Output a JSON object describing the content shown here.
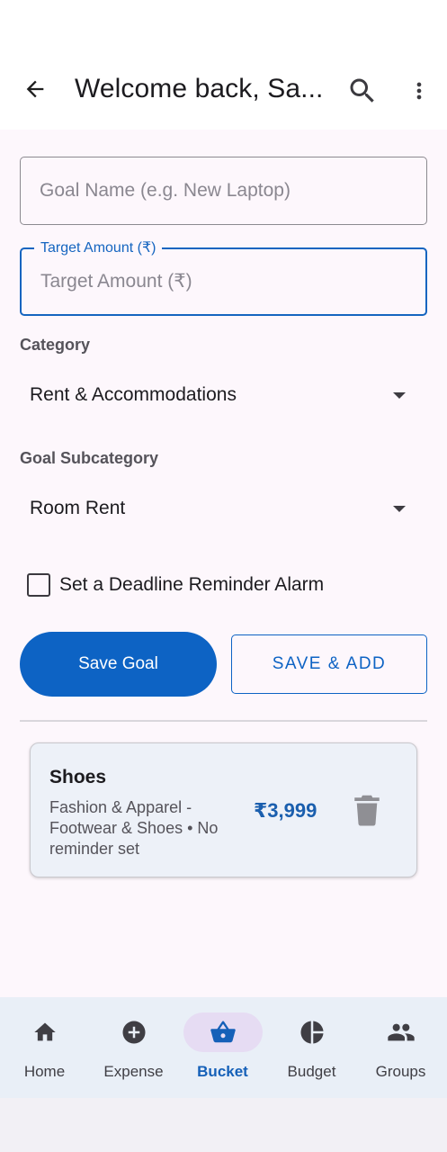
{
  "app_bar": {
    "title": "Welcome back, Sa...",
    "icons": {
      "back": "arrow-left-icon",
      "search": "search-icon",
      "more": "more-vertical-icon"
    }
  },
  "form": {
    "goal_name": {
      "value": "",
      "placeholder": "Goal Name (e.g. New Laptop)"
    },
    "target_amount": {
      "label": "Target Amount (₹)",
      "value": "",
      "placeholder": "Target Amount (₹)"
    },
    "category": {
      "label": "Category",
      "selected": "Rent & Accommodations"
    },
    "subcategory": {
      "label": "Goal Subcategory",
      "selected": "Room Rent"
    },
    "deadline_checkbox": {
      "label": "Set a Deadline Reminder Alarm",
      "checked": false
    },
    "save_button": "Save Goal",
    "save_add_button": "SAVE & ADD"
  },
  "goals": [
    {
      "name": "Shoes",
      "meta": "Fashion & Apparel - Footwear & Shoes  •  No reminder set",
      "amount": "₹3,999"
    }
  ],
  "bottom_nav": {
    "items": [
      {
        "label": "Home",
        "icon": "home-icon",
        "active": false
      },
      {
        "label": "Expense",
        "icon": "add-circle-icon",
        "active": false
      },
      {
        "label": "Bucket",
        "icon": "basket-icon",
        "active": true
      },
      {
        "label": "Budget",
        "icon": "pie-chart-icon",
        "active": false
      },
      {
        "label": "Groups",
        "icon": "groups-icon",
        "active": false
      }
    ]
  },
  "colors": {
    "primary": "#0d63c4",
    "background": "#fdf7fc",
    "card": "#edf1f8",
    "nav_background": "#e9eff7",
    "nav_active_pill": "#e6dcf3"
  }
}
